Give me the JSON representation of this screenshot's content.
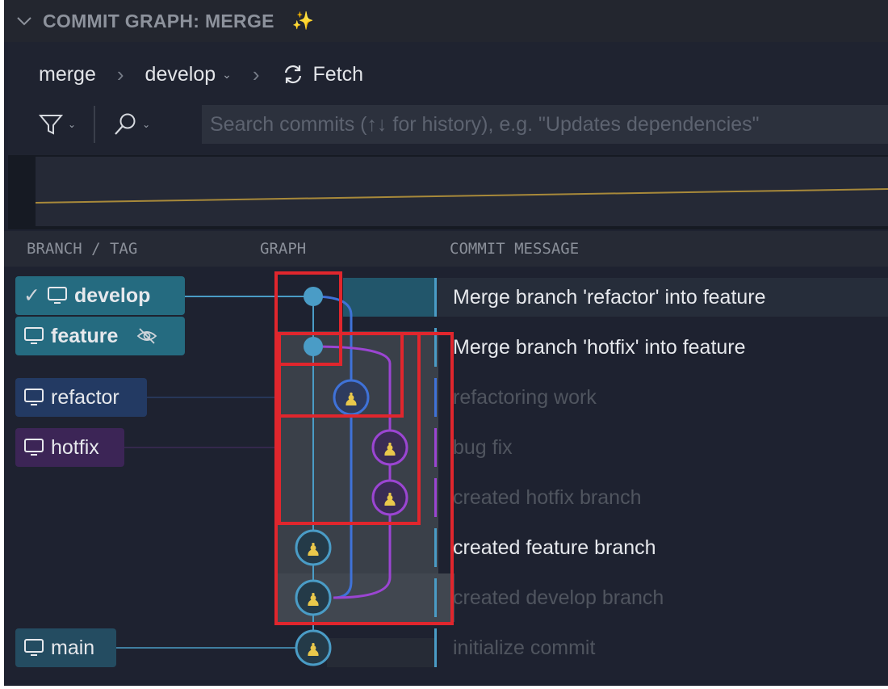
{
  "panel": {
    "title": "COMMIT GRAPH: MERGE"
  },
  "breadcrumb": {
    "repo": "merge",
    "branch": "develop",
    "fetch_label": "Fetch"
  },
  "search": {
    "placeholder": "Search commits (↑↓ for history), e.g. \"Updates dependencies\""
  },
  "columns": {
    "branch_tag": "BRANCH / TAG",
    "graph": "GRAPH",
    "commit_message": "COMMIT MESSAGE"
  },
  "refs": [
    {
      "label": "develop",
      "icon": "monitor-icon",
      "checked": true,
      "color": "#256b80"
    },
    {
      "label": "feature",
      "icon": "monitor-icon",
      "hidden_icon": "eye-off-icon",
      "color": "#256b80"
    },
    {
      "label": "refactor",
      "icon": "monitor-icon",
      "color": "#233a63"
    },
    {
      "label": "hotfix",
      "icon": "monitor-icon",
      "color": "#3c2556"
    },
    {
      "label": "main",
      "icon": "monitor-icon",
      "color": "#244c61"
    }
  ],
  "commits": [
    {
      "message": "Merge branch 'refactor' into feature",
      "lane": 0,
      "avatar": false,
      "bright": true
    },
    {
      "message": "Merge branch 'hotfix' into feature",
      "lane": 0,
      "avatar": false,
      "bright": true
    },
    {
      "message": "refactoring work",
      "lane": 1,
      "avatar": true,
      "bright": false
    },
    {
      "message": "bug fix",
      "lane": 2,
      "avatar": true,
      "bright": false
    },
    {
      "message": "created hotfix branch",
      "lane": 2,
      "avatar": true,
      "bright": false
    },
    {
      "message": "created feature branch",
      "lane": 0,
      "avatar": true,
      "bright": true
    },
    {
      "message": "created develop branch",
      "lane": 0,
      "avatar": true,
      "bright": false
    },
    {
      "message": "initialize commit",
      "lane": 0,
      "avatar": true,
      "bright": false
    }
  ],
  "colors": {
    "lane_main": "#4a9cc6",
    "lane_refactor": "#3f72d8",
    "lane_hotfix": "#9b45d2",
    "highlight_box": "#e0262d",
    "sparkle": "#e9c84b"
  }
}
